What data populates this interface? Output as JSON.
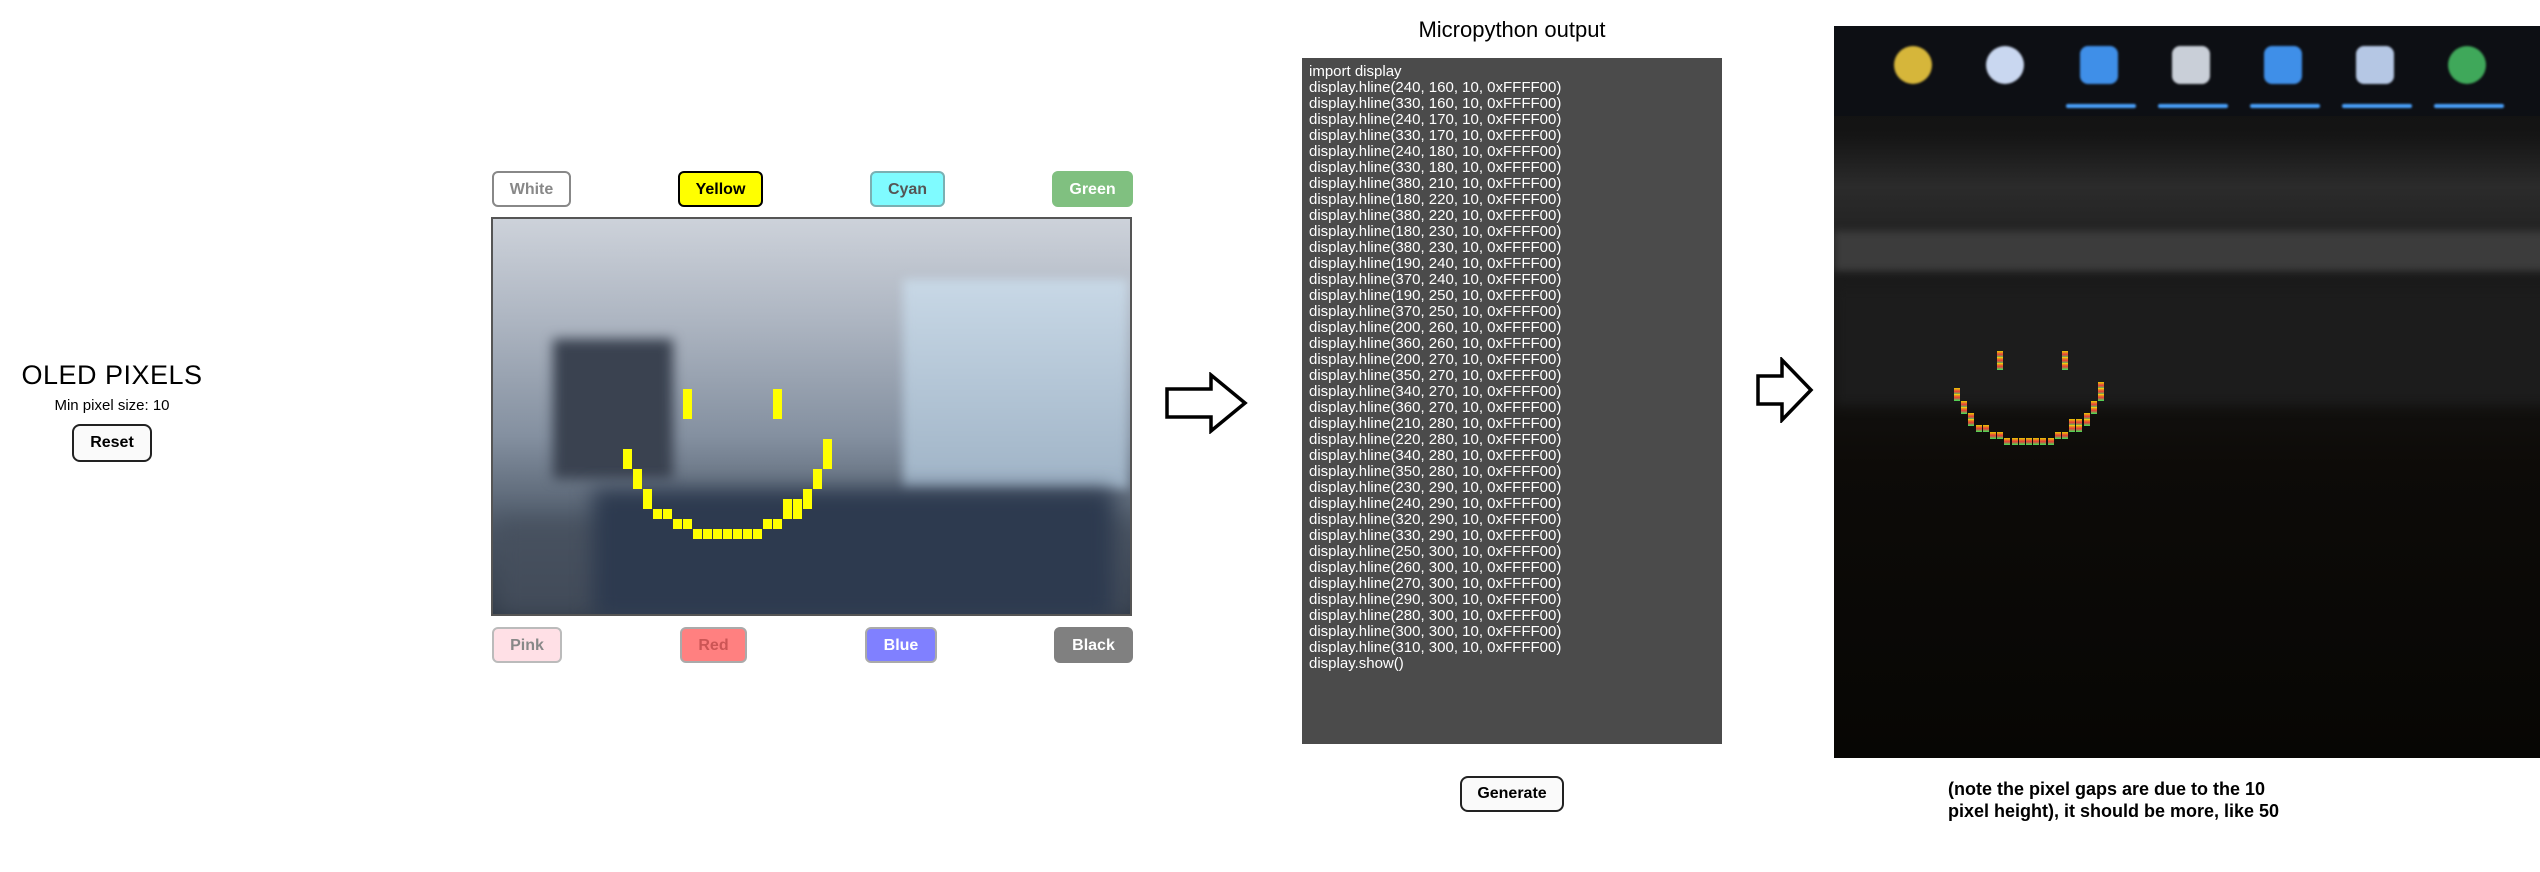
{
  "app": {
    "title": "OLED PIXELS",
    "min_pixel_size": "Min pixel size: 10",
    "reset_label": "Reset"
  },
  "palette": {
    "top": [
      {
        "label": "White",
        "bg": "#ffffff",
        "fg": "#888888",
        "border": "#888888"
      },
      {
        "label": "Yellow",
        "bg": "#ffff00",
        "fg": "#000000",
        "border": "#000000"
      },
      {
        "label": "Cyan",
        "bg": "#7ffbff",
        "fg": "#555555",
        "border": "#7ab0b3"
      },
      {
        "label": "Green",
        "bg": "#80c080",
        "fg": "#ffffff",
        "border": "#80c080"
      }
    ],
    "bottom": [
      {
        "label": "Pink",
        "bg": "#ffe0e6",
        "fg": "#888888",
        "border": "#bbbbbb"
      },
      {
        "label": "Red",
        "bg": "#ff8080",
        "fg": "#cc5555",
        "border": "#aaaaaa"
      },
      {
        "label": "Blue",
        "bg": "#8080ff",
        "fg": "#ffffff",
        "border": "#aaaaaa"
      },
      {
        "label": "Black",
        "bg": "#808080",
        "fg": "#ffffff",
        "border": "#808080"
      }
    ],
    "selected": "Yellow"
  },
  "output": {
    "title": "Micropython output",
    "lines": [
      "import display",
      "display.hline(240, 160, 10, 0xFFFF00)",
      "display.hline(330, 160, 10, 0xFFFF00)",
      "display.hline(240, 170, 10, 0xFFFF00)",
      "display.hline(330, 170, 10, 0xFFFF00)",
      "display.hline(240, 180, 10, 0xFFFF00)",
      "display.hline(330, 180, 10, 0xFFFF00)",
      "display.hline(380, 210, 10, 0xFFFF00)",
      "display.hline(180, 220, 10, 0xFFFF00)",
      "display.hline(380, 220, 10, 0xFFFF00)",
      "display.hline(180, 230, 10, 0xFFFF00)",
      "display.hline(380, 230, 10, 0xFFFF00)",
      "display.hline(190, 240, 10, 0xFFFF00)",
      "display.hline(370, 240, 10, 0xFFFF00)",
      "display.hline(190, 250, 10, 0xFFFF00)",
      "display.hline(370, 250, 10, 0xFFFF00)",
      "display.hline(200, 260, 10, 0xFFFF00)",
      "display.hline(360, 260, 10, 0xFFFF00)",
      "display.hline(200, 270, 10, 0xFFFF00)",
      "display.hline(350, 270, 10, 0xFFFF00)",
      "display.hline(340, 270, 10, 0xFFFF00)",
      "display.hline(360, 270, 10, 0xFFFF00)",
      "display.hline(210, 280, 10, 0xFFFF00)",
      "display.hline(220, 280, 10, 0xFFFF00)",
      "display.hline(340, 280, 10, 0xFFFF00)",
      "display.hline(350, 280, 10, 0xFFFF00)",
      "display.hline(230, 290, 10, 0xFFFF00)",
      "display.hline(240, 290, 10, 0xFFFF00)",
      "display.hline(320, 290, 10, 0xFFFF00)",
      "display.hline(330, 290, 10, 0xFFFF00)",
      "display.hline(250, 300, 10, 0xFFFF00)",
      "display.hline(260, 300, 10, 0xFFFF00)",
      "display.hline(270, 300, 10, 0xFFFF00)",
      "display.hline(290, 300, 10, 0xFFFF00)",
      "display.hline(280, 300, 10, 0xFFFF00)",
      "display.hline(300, 300, 10, 0xFFFF00)",
      "display.hline(310, 300, 10, 0xFFFF00)",
      "display.show()"
    ],
    "generate_label": "Generate"
  },
  "note": {
    "text": "(note the pixel gaps are due to the 10 pixel height), it should be more, like 50"
  }
}
